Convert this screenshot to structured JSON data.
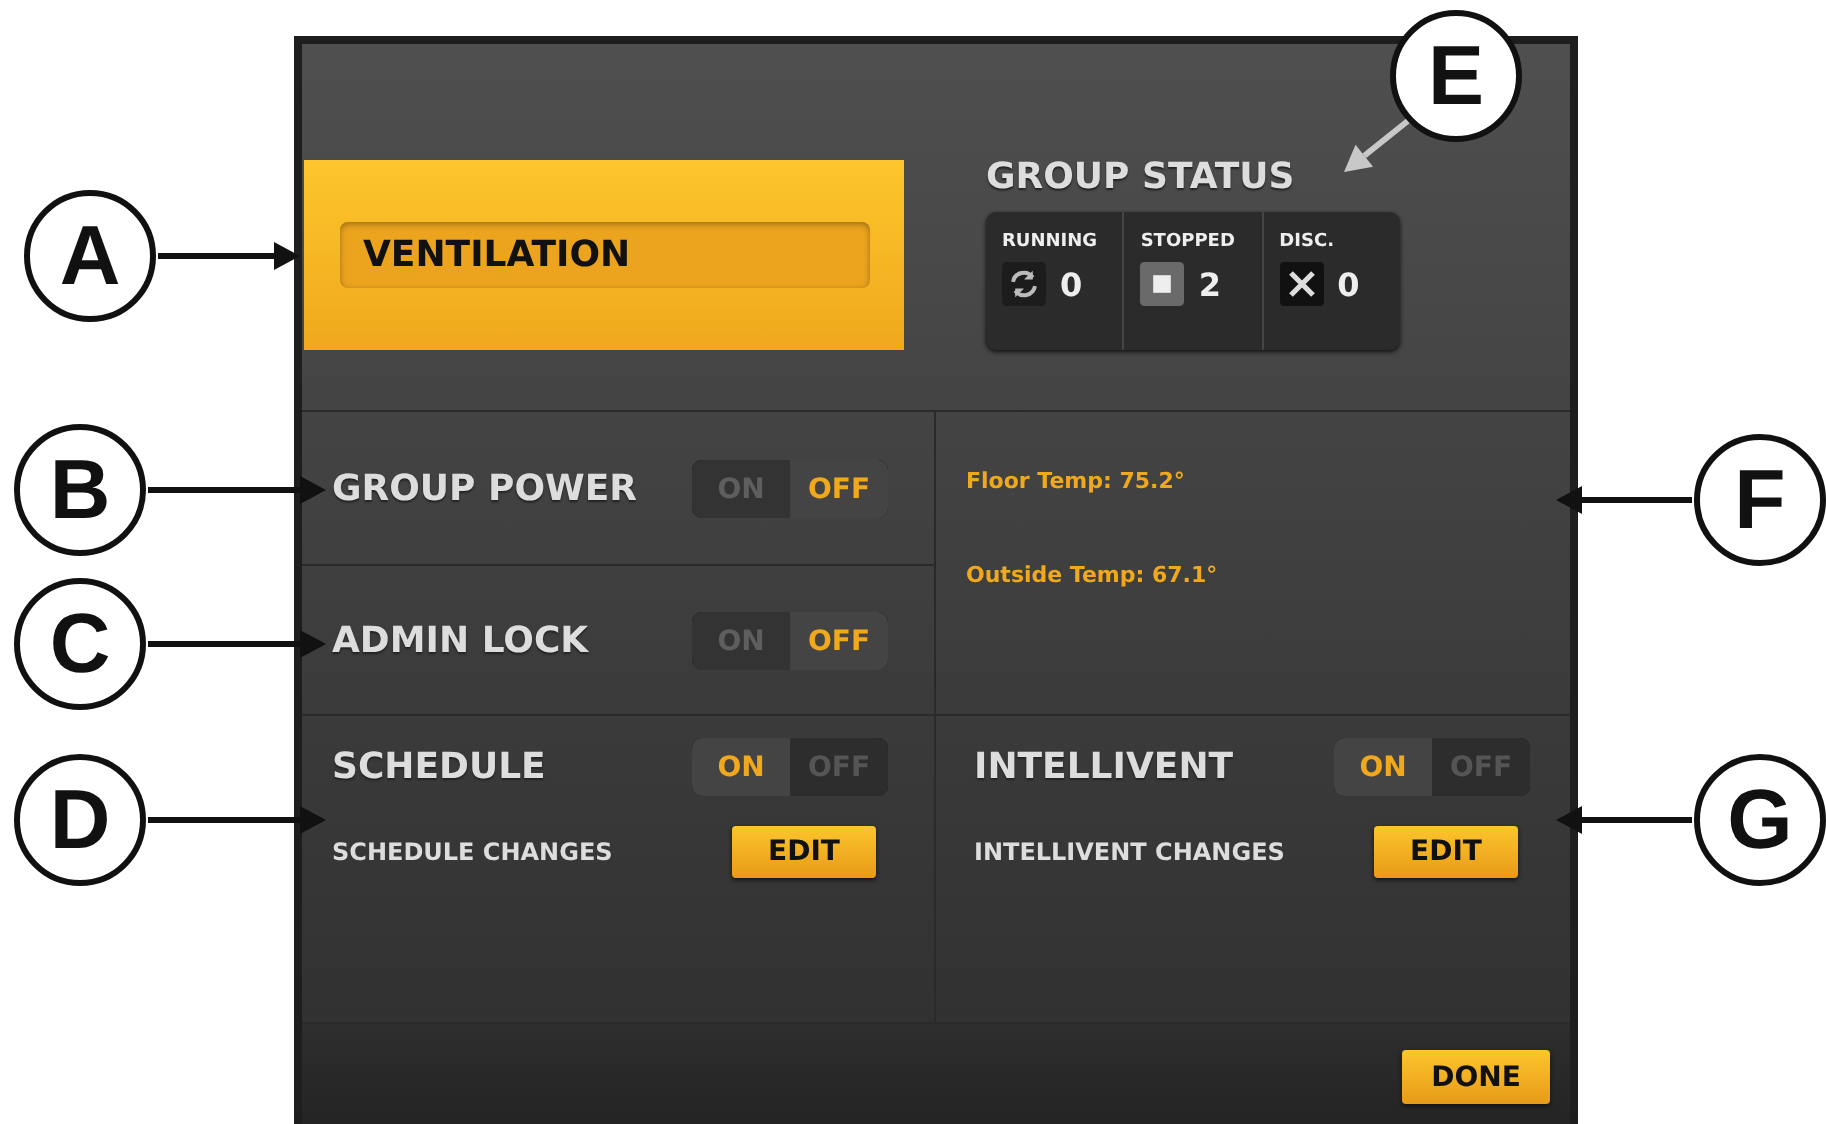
{
  "group_name": "VENTILATION",
  "group_status": {
    "title": "GROUP STATUS",
    "items": [
      {
        "kind": "running",
        "label": "RUNNING",
        "count": "0"
      },
      {
        "kind": "stopped",
        "label": "STOPPED",
        "count": "2"
      },
      {
        "kind": "disconnected",
        "label": "DISC.",
        "count": "0"
      }
    ]
  },
  "group_power": {
    "label": "GROUP POWER",
    "on_label": "ON",
    "off_label": "OFF",
    "on": false
  },
  "admin_lock": {
    "label": "ADMIN LOCK",
    "on_label": "ON",
    "off_label": "OFF",
    "on": false
  },
  "readings": [
    "Floor Temp: 75.2°",
    "Outside Temp: 67.1°"
  ],
  "schedule": {
    "label": "SCHEDULE",
    "on_label": "ON",
    "off_label": "OFF",
    "on": true,
    "changes_label": "SCHEDULE CHANGES",
    "edit_button": "EDIT"
  },
  "intellivent": {
    "label": "INTELLIVENT",
    "on_label": "ON",
    "off_label": "OFF",
    "on": true,
    "changes_label": "INTELLIVENT CHANGES",
    "edit_button": "EDIT"
  },
  "done_button": "DONE",
  "callouts": [
    {
      "letter": "A"
    },
    {
      "letter": "B"
    },
    {
      "letter": "C"
    },
    {
      "letter": "D"
    },
    {
      "letter": "E"
    },
    {
      "letter": "F"
    },
    {
      "letter": "G"
    }
  ]
}
